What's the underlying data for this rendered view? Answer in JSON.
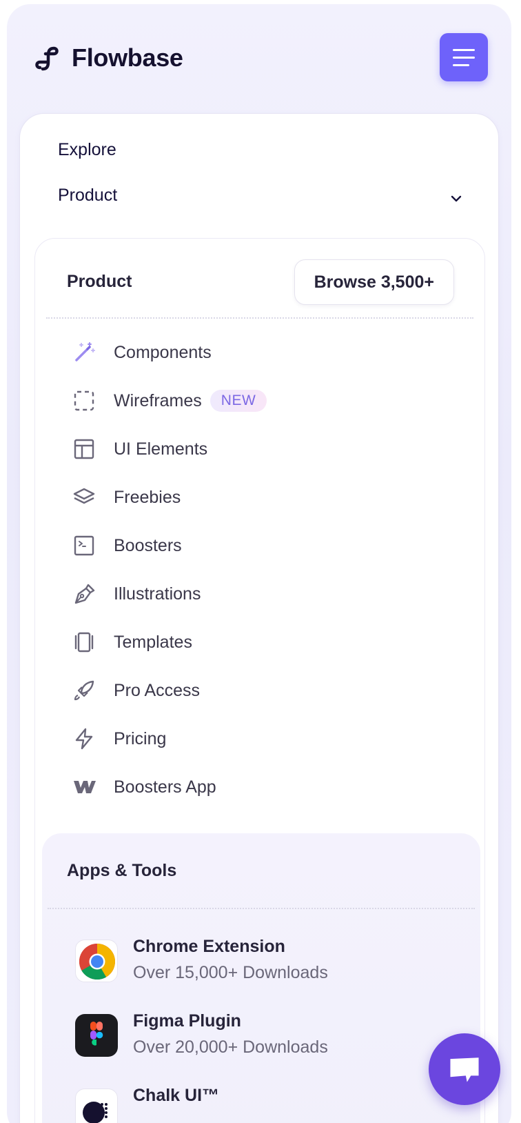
{
  "brand": {
    "name": "Flowbase",
    "accent": "#6e62fa"
  },
  "nav": {
    "explore_label": "Explore",
    "product_label": "Product"
  },
  "product_panel": {
    "title": "Product",
    "browse_label": "Browse 3,500+",
    "items": [
      {
        "label": "Components",
        "icon": "magic-wand-icon"
      },
      {
        "label": "Wireframes",
        "icon": "dashed-square-icon",
        "badge": "NEW"
      },
      {
        "label": "UI Elements",
        "icon": "layout-icon"
      },
      {
        "label": "Freebies",
        "icon": "layers-icon"
      },
      {
        "label": "Boosters",
        "icon": "terminal-icon"
      },
      {
        "label": "Illustrations",
        "icon": "pen-tool-icon"
      },
      {
        "label": "Templates",
        "icon": "columns-icon"
      },
      {
        "label": "Pro Access",
        "icon": "rocket-icon"
      },
      {
        "label": "Pricing",
        "icon": "lightning-icon"
      },
      {
        "label": "Boosters App",
        "icon": "webflow-logo-icon"
      }
    ]
  },
  "apps_tools": {
    "title": "Apps & Tools",
    "apps": [
      {
        "name": "Chrome Extension",
        "subtitle": "Over 15,000+ Downloads",
        "icon": "chrome-icon"
      },
      {
        "name": "Figma Plugin",
        "subtitle": "Over 20,000+ Downloads",
        "icon": "figma-icon"
      },
      {
        "name": "Chalk UI™",
        "subtitle": "",
        "icon": "chalk-ui-icon"
      }
    ]
  },
  "chat": {
    "icon": "chat-bubble-icon",
    "color": "#6b46df"
  }
}
